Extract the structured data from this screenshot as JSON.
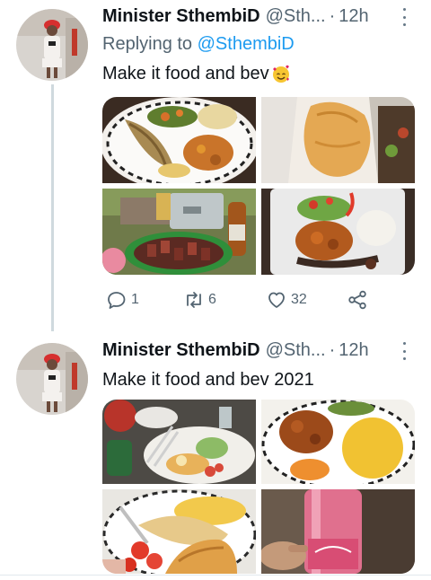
{
  "tweets": [
    {
      "name": "Minister SthembiD",
      "handle": "@Sth...",
      "separator": "·",
      "time": "12h",
      "replying_prefix": "Replying to ",
      "replying_handle": "@SthembiD",
      "text": "Make it food and bev",
      "emoji": "smiling-face-with-hearts-emoji",
      "photos": [
        "fish-vegetables-plate",
        "omelette-plate",
        "braai-meat-and-beer",
        "curry-rice-salad-plate"
      ],
      "stats": {
        "replies": "1",
        "retweets": "6",
        "likes": "32"
      }
    },
    {
      "name": "Minister SthembiD",
      "handle": "@Sth...",
      "separator": "·",
      "time": "12h",
      "text": "Make it food and bev 2021",
      "photos": [
        "breakfast-table",
        "curry-and-yellow-rice",
        "croissant-omelette-breakfast",
        "pink-wine-bottle"
      ]
    }
  ],
  "colors": {
    "link": "#1d9bf0",
    "secondary": "#536471",
    "thread_line": "#cfd9de"
  }
}
